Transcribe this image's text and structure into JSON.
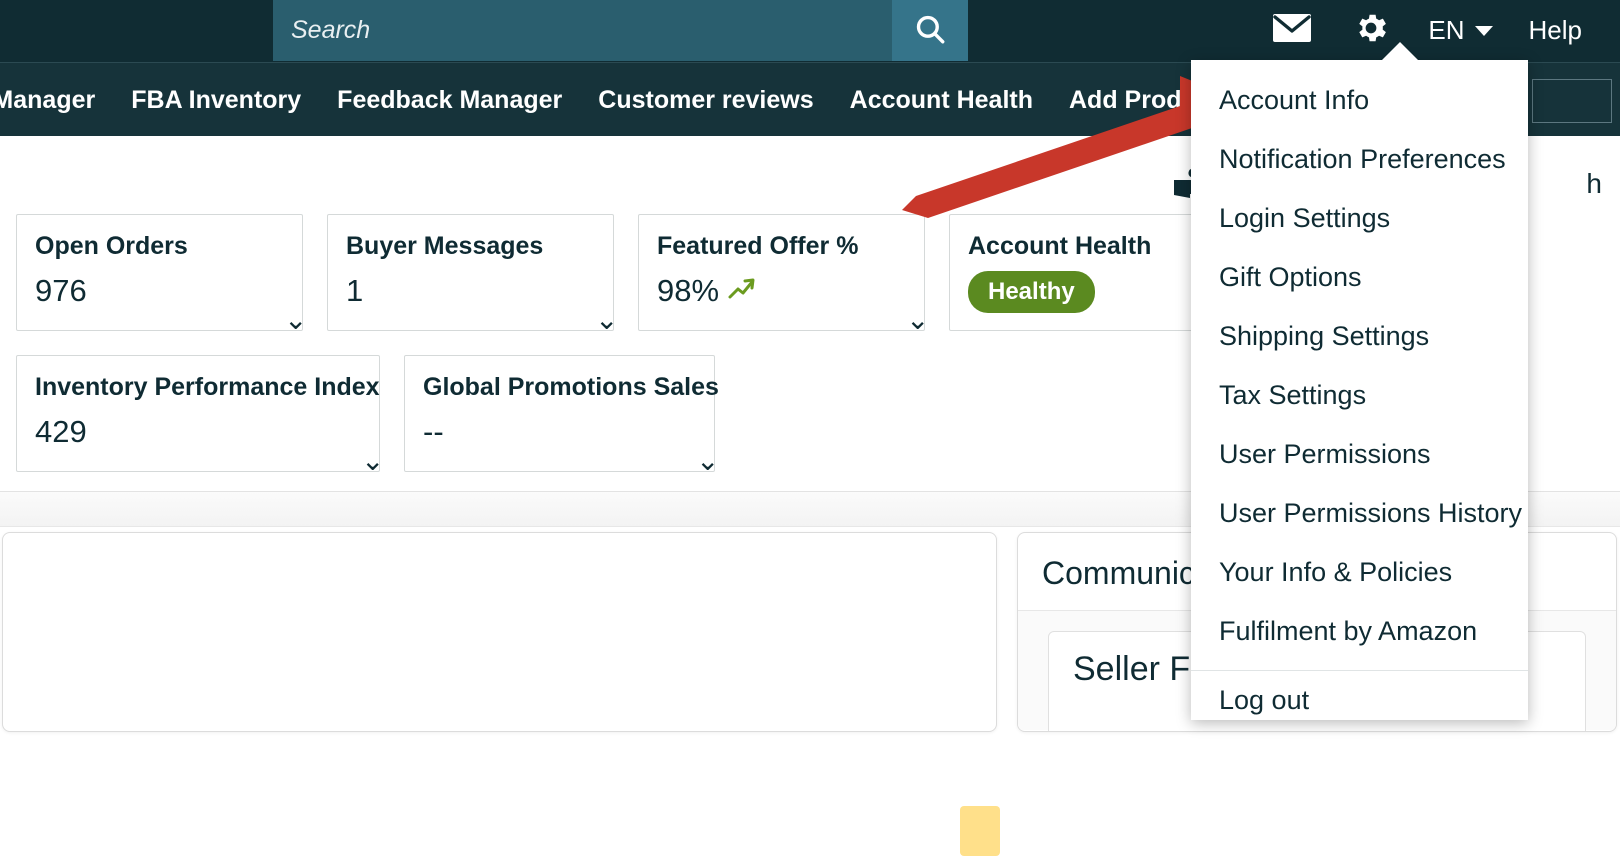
{
  "header": {
    "search": {
      "placeholder": "Search",
      "value": "",
      "button_icon": "search-icon"
    },
    "mail_icon": "envelope-icon",
    "settings_icon": "gear-icon",
    "language": "EN",
    "help_label": "Help"
  },
  "nav": {
    "items": [
      {
        "label": "ign Manager"
      },
      {
        "label": "FBA Inventory"
      },
      {
        "label": "Feedback Manager"
      },
      {
        "label": "Customer reviews"
      },
      {
        "label": "Account Health"
      },
      {
        "label": "Add Products via"
      }
    ],
    "search_value": ""
  },
  "main": {
    "book_icon": "book-reader-icon",
    "truncated_text": "h",
    "cards_row_1": [
      {
        "title": "Open Orders",
        "value": "976",
        "has_caret": true,
        "trend": ""
      },
      {
        "title": "Buyer Messages",
        "value": "1",
        "has_caret": true,
        "trend": ""
      },
      {
        "title": "Featured Offer %",
        "value": "98%",
        "has_caret": true,
        "trend": "trending-up-icon"
      },
      {
        "title": "Account Health",
        "value": "",
        "has_caret": true,
        "badge": "Healthy"
      }
    ],
    "cards_row_2": [
      {
        "title": "Inventory Performance Index",
        "value": "429",
        "has_caret": true
      },
      {
        "title": "Global Promotions Sales",
        "value": "--",
        "has_caret": true
      }
    ],
    "panel_right": {
      "title": "Communicatio",
      "card_title": "Seller For"
    }
  },
  "dropdown": {
    "items": [
      "Account Info",
      "Notification Preferences",
      "Login Settings",
      "Gift Options",
      "Shipping Settings",
      "Tax Settings",
      "User Permissions",
      "User Permissions History",
      "Your Info & Policies",
      "Fulfilment by Amazon"
    ],
    "logout": "Log out"
  },
  "annotation": {
    "arrow_color": "#C8372A",
    "arrow_points_to": "Account Info"
  },
  "colors": {
    "header_bg": "#102C33",
    "nav_bg": "#16333A",
    "search_bg": "#2A5E6E",
    "search_btn_bg": "#35748A",
    "accent_green": "#5B8A20",
    "text_dark": "#0F2B33"
  }
}
